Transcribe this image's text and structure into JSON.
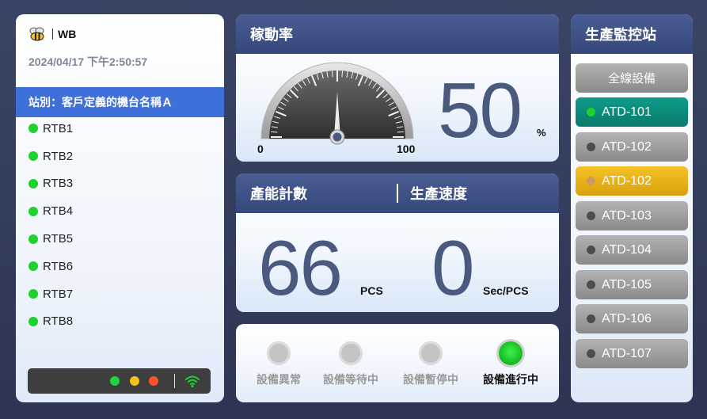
{
  "left": {
    "brand": "WB",
    "datetime": "2024/04/17  下午2:50:57",
    "station": "站別：客戶定義的機台名稱Ａ",
    "rtbs": [
      "RTB1",
      "RTB2",
      "RTB3",
      "RTB4",
      "RTB5",
      "RTB6",
      "RTB7",
      "RTB8"
    ],
    "status_lights": [
      "green",
      "yellow",
      "red"
    ],
    "wifi_icon": "wifi-icon"
  },
  "utilization": {
    "title": "稼動率",
    "gauge_min": "0",
    "gauge_max": "100",
    "gauge_value": 50,
    "value": "50",
    "unit": "%"
  },
  "capacity": {
    "title_left": "產能計數",
    "title_right": "生產速度",
    "count": "66",
    "count_unit": "PCS",
    "speed": "0",
    "speed_unit": "Sec/PCS"
  },
  "equipment_status": [
    {
      "label": "設備異常",
      "active": false
    },
    {
      "label": "設備等待中",
      "active": false
    },
    {
      "label": "設備暫停中",
      "active": false
    },
    {
      "label": "設備進行中",
      "active": true
    }
  ],
  "monitor": {
    "title": "生產監控站",
    "all_label": "全線設備",
    "stations": [
      {
        "label": "ATD-101",
        "state": "active",
        "color": "#0e9c8a"
      },
      {
        "label": "ATD-102",
        "state": "idle",
        "color": "#9e9e9e"
      },
      {
        "label": "ATD-102",
        "state": "warning",
        "color": "#f5c326"
      },
      {
        "label": "ATD-103",
        "state": "idle",
        "color": "#9e9e9e"
      },
      {
        "label": "ATD-104",
        "state": "idle",
        "color": "#9e9e9e"
      },
      {
        "label": "ATD-105",
        "state": "idle",
        "color": "#9e9e9e"
      },
      {
        "label": "ATD-106",
        "state": "idle",
        "color": "#9e9e9e"
      },
      {
        "label": "ATD-107",
        "state": "idle",
        "color": "#9e9e9e"
      }
    ]
  }
}
